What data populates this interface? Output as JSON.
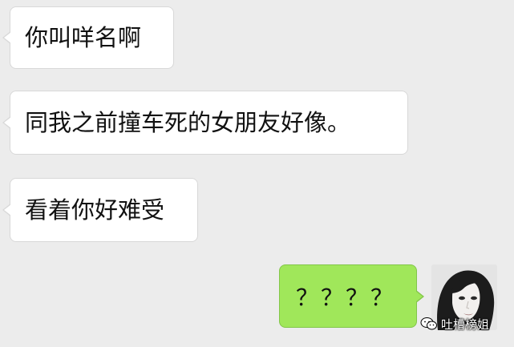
{
  "chat": {
    "messages": [
      {
        "side": "left",
        "text": "你叫咩名啊"
      },
      {
        "side": "left",
        "text": "同我之前撞车死的女朋友好像。"
      },
      {
        "side": "left",
        "text": "看着你好难受"
      },
      {
        "side": "right",
        "text": "？？？？"
      }
    ]
  },
  "watermark": {
    "text": "吐槽榜姐"
  },
  "colors": {
    "background": "#ececec",
    "incoming_bubble": "#ffffff",
    "outgoing_bubble": "#a0e75a"
  },
  "icons": {
    "avatar": "avatar-photo",
    "watermark": "wechat-icon"
  }
}
